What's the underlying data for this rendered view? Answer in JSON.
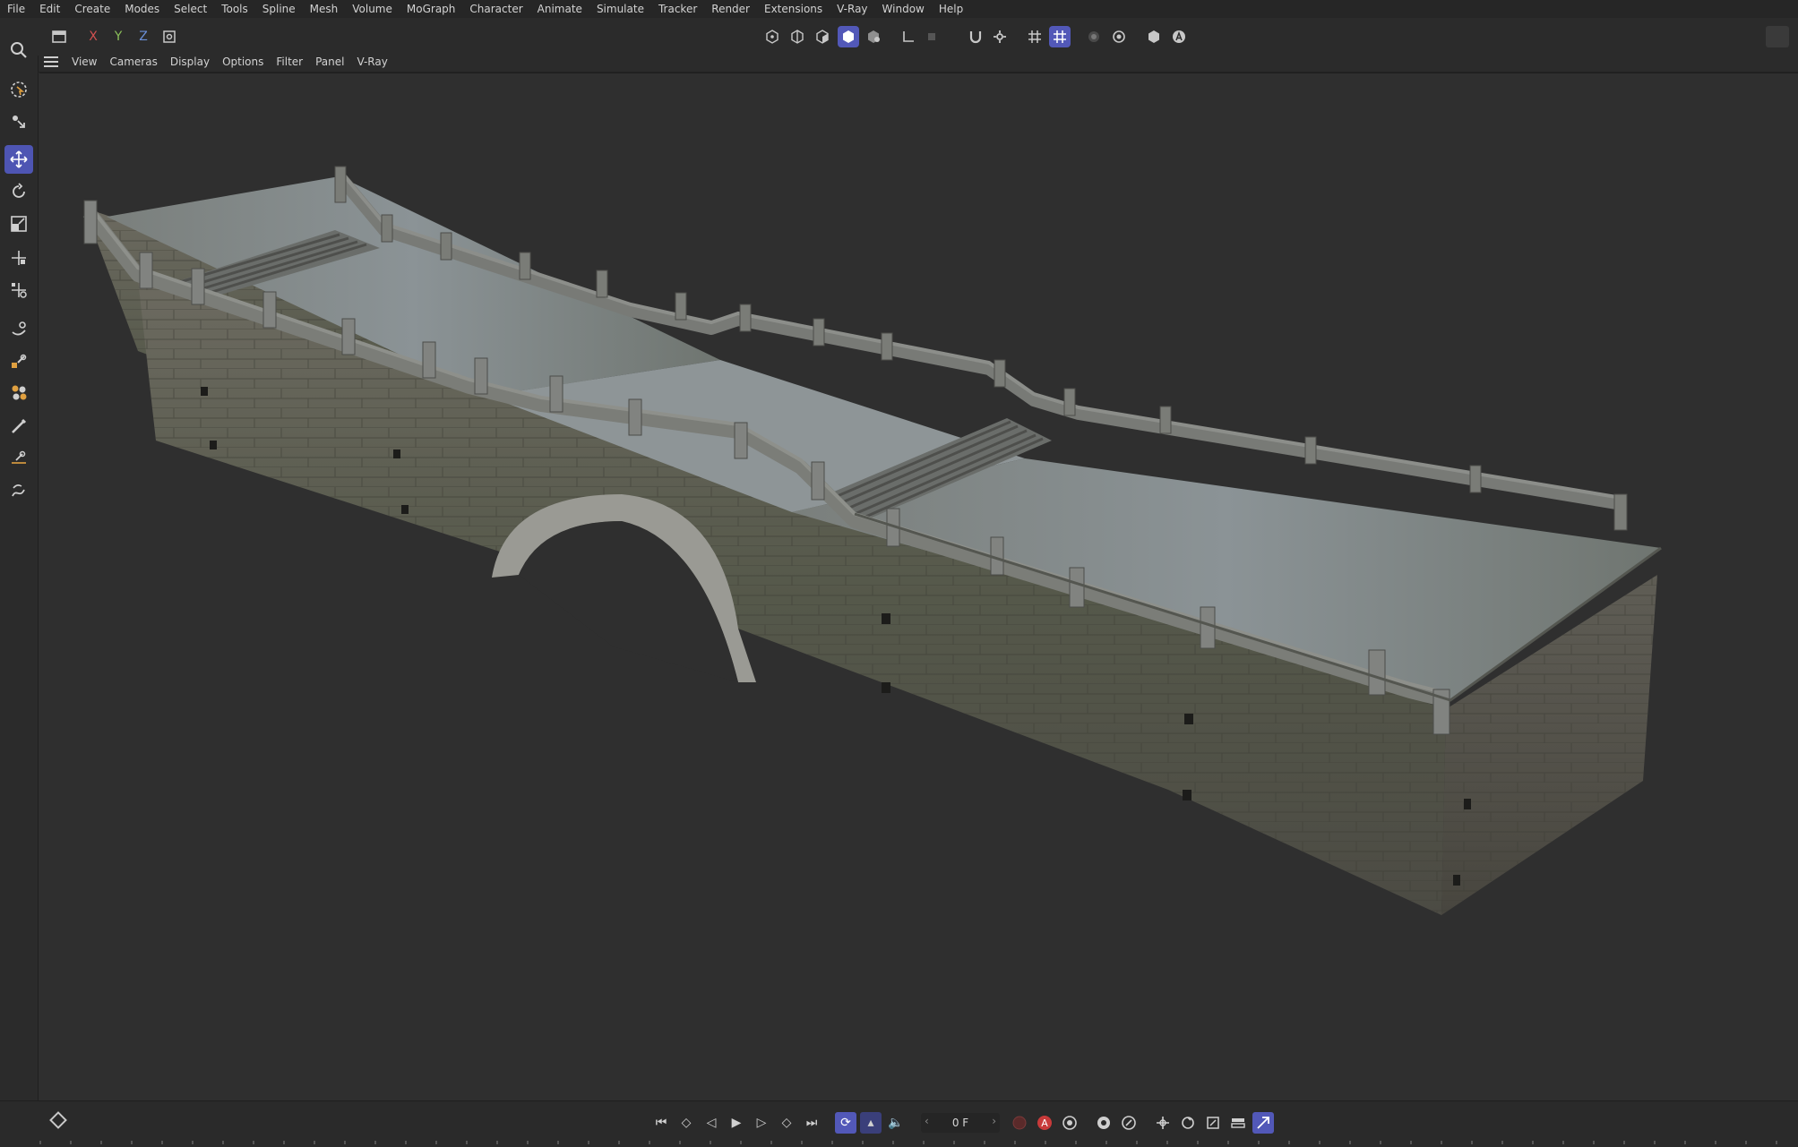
{
  "menubar": {
    "items": [
      "File",
      "Edit",
      "Create",
      "Modes",
      "Select",
      "Tools",
      "Spline",
      "Mesh",
      "Volume",
      "MoGraph",
      "Character",
      "Animate",
      "Simulate",
      "Tracker",
      "Render",
      "Extensions",
      "V-Ray",
      "Window",
      "Help"
    ]
  },
  "toolbar": {
    "axis_x": "X",
    "axis_y": "Y",
    "axis_z": "Z"
  },
  "viewport_menu": {
    "items": [
      "View",
      "Cameras",
      "Display",
      "Options",
      "Filter",
      "Panel",
      "V-Ray"
    ]
  },
  "left_tools": [
    "search-icon",
    "live-select-icon",
    "selection-tool-icon",
    "move-icon",
    "rotate-icon",
    "scale-icon",
    "transform-icon",
    "multi-transform-icon",
    "knife-icon",
    "polygon-pen-icon",
    "extrude-icon",
    "brush-icon",
    "magnet-icon",
    "spline-pen-icon"
  ],
  "timeline": {
    "frame": "0 F",
    "record_label": "A"
  },
  "colors": {
    "accent": "#5258b8",
    "background": "#2f2f2f",
    "record": "#c83a3a"
  }
}
